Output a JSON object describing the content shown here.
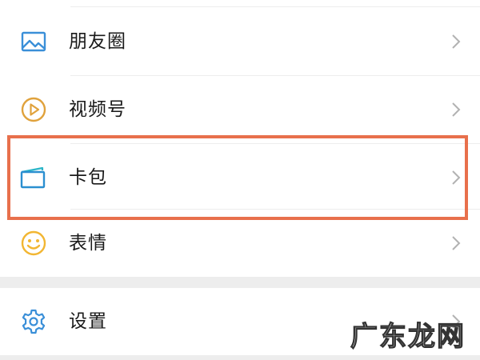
{
  "menu": {
    "items": [
      {
        "label": "朋友圈",
        "icon": "album-icon",
        "color": "#3a8fd8"
      },
      {
        "label": "视频号",
        "icon": "play-circle-icon",
        "color": "#e0a23c"
      },
      {
        "label": "卡包",
        "icon": "card-icon",
        "color": "#2b8fd0"
      },
      {
        "label": "表情",
        "icon": "smile-icon",
        "color": "#f2b632"
      },
      {
        "label": "设置",
        "icon": "gear-icon",
        "color": "#3a8fd8"
      }
    ]
  },
  "highlight": {
    "target": "卡包",
    "color": "#e8704c"
  },
  "watermark": {
    "text": "广东龙网"
  }
}
